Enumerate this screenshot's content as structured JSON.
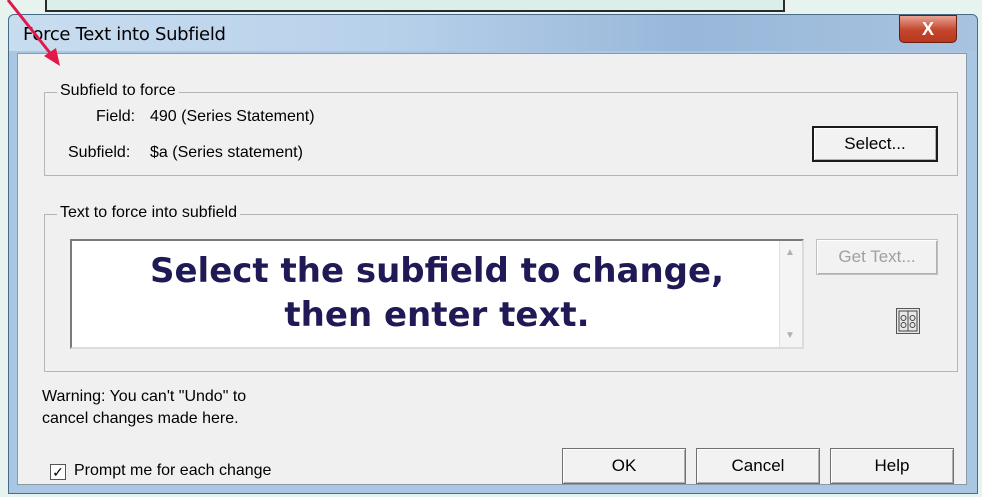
{
  "window": {
    "title": "Force Text into Subfield",
    "close_label": "X"
  },
  "subfield_group": {
    "legend": "Subfield to force",
    "field_label": "Field:",
    "field_value": "490 (Series Statement)",
    "subfield_label": "Subfield:",
    "subfield_value": "$a (Series statement)",
    "select_button": "Select..."
  },
  "text_group": {
    "legend": "Text to force into subfield",
    "input_value": "",
    "get_text_button": "Get Text..."
  },
  "overlay": {
    "line1": "Select the subfield to change,",
    "line2": "then enter text."
  },
  "warning": {
    "line1": "Warning: You can't \"Undo\" to",
    "line2": "cancel changes made here."
  },
  "prompt_checkbox": {
    "label": "Prompt me for each change",
    "checked": true,
    "mark": "✓"
  },
  "buttons": {
    "ok": "OK",
    "cancel": "Cancel",
    "help": "Help"
  },
  "colors": {
    "overlay_text": "#1f1a55",
    "arrow": "#e0194a",
    "close_button": "#c4442c"
  }
}
